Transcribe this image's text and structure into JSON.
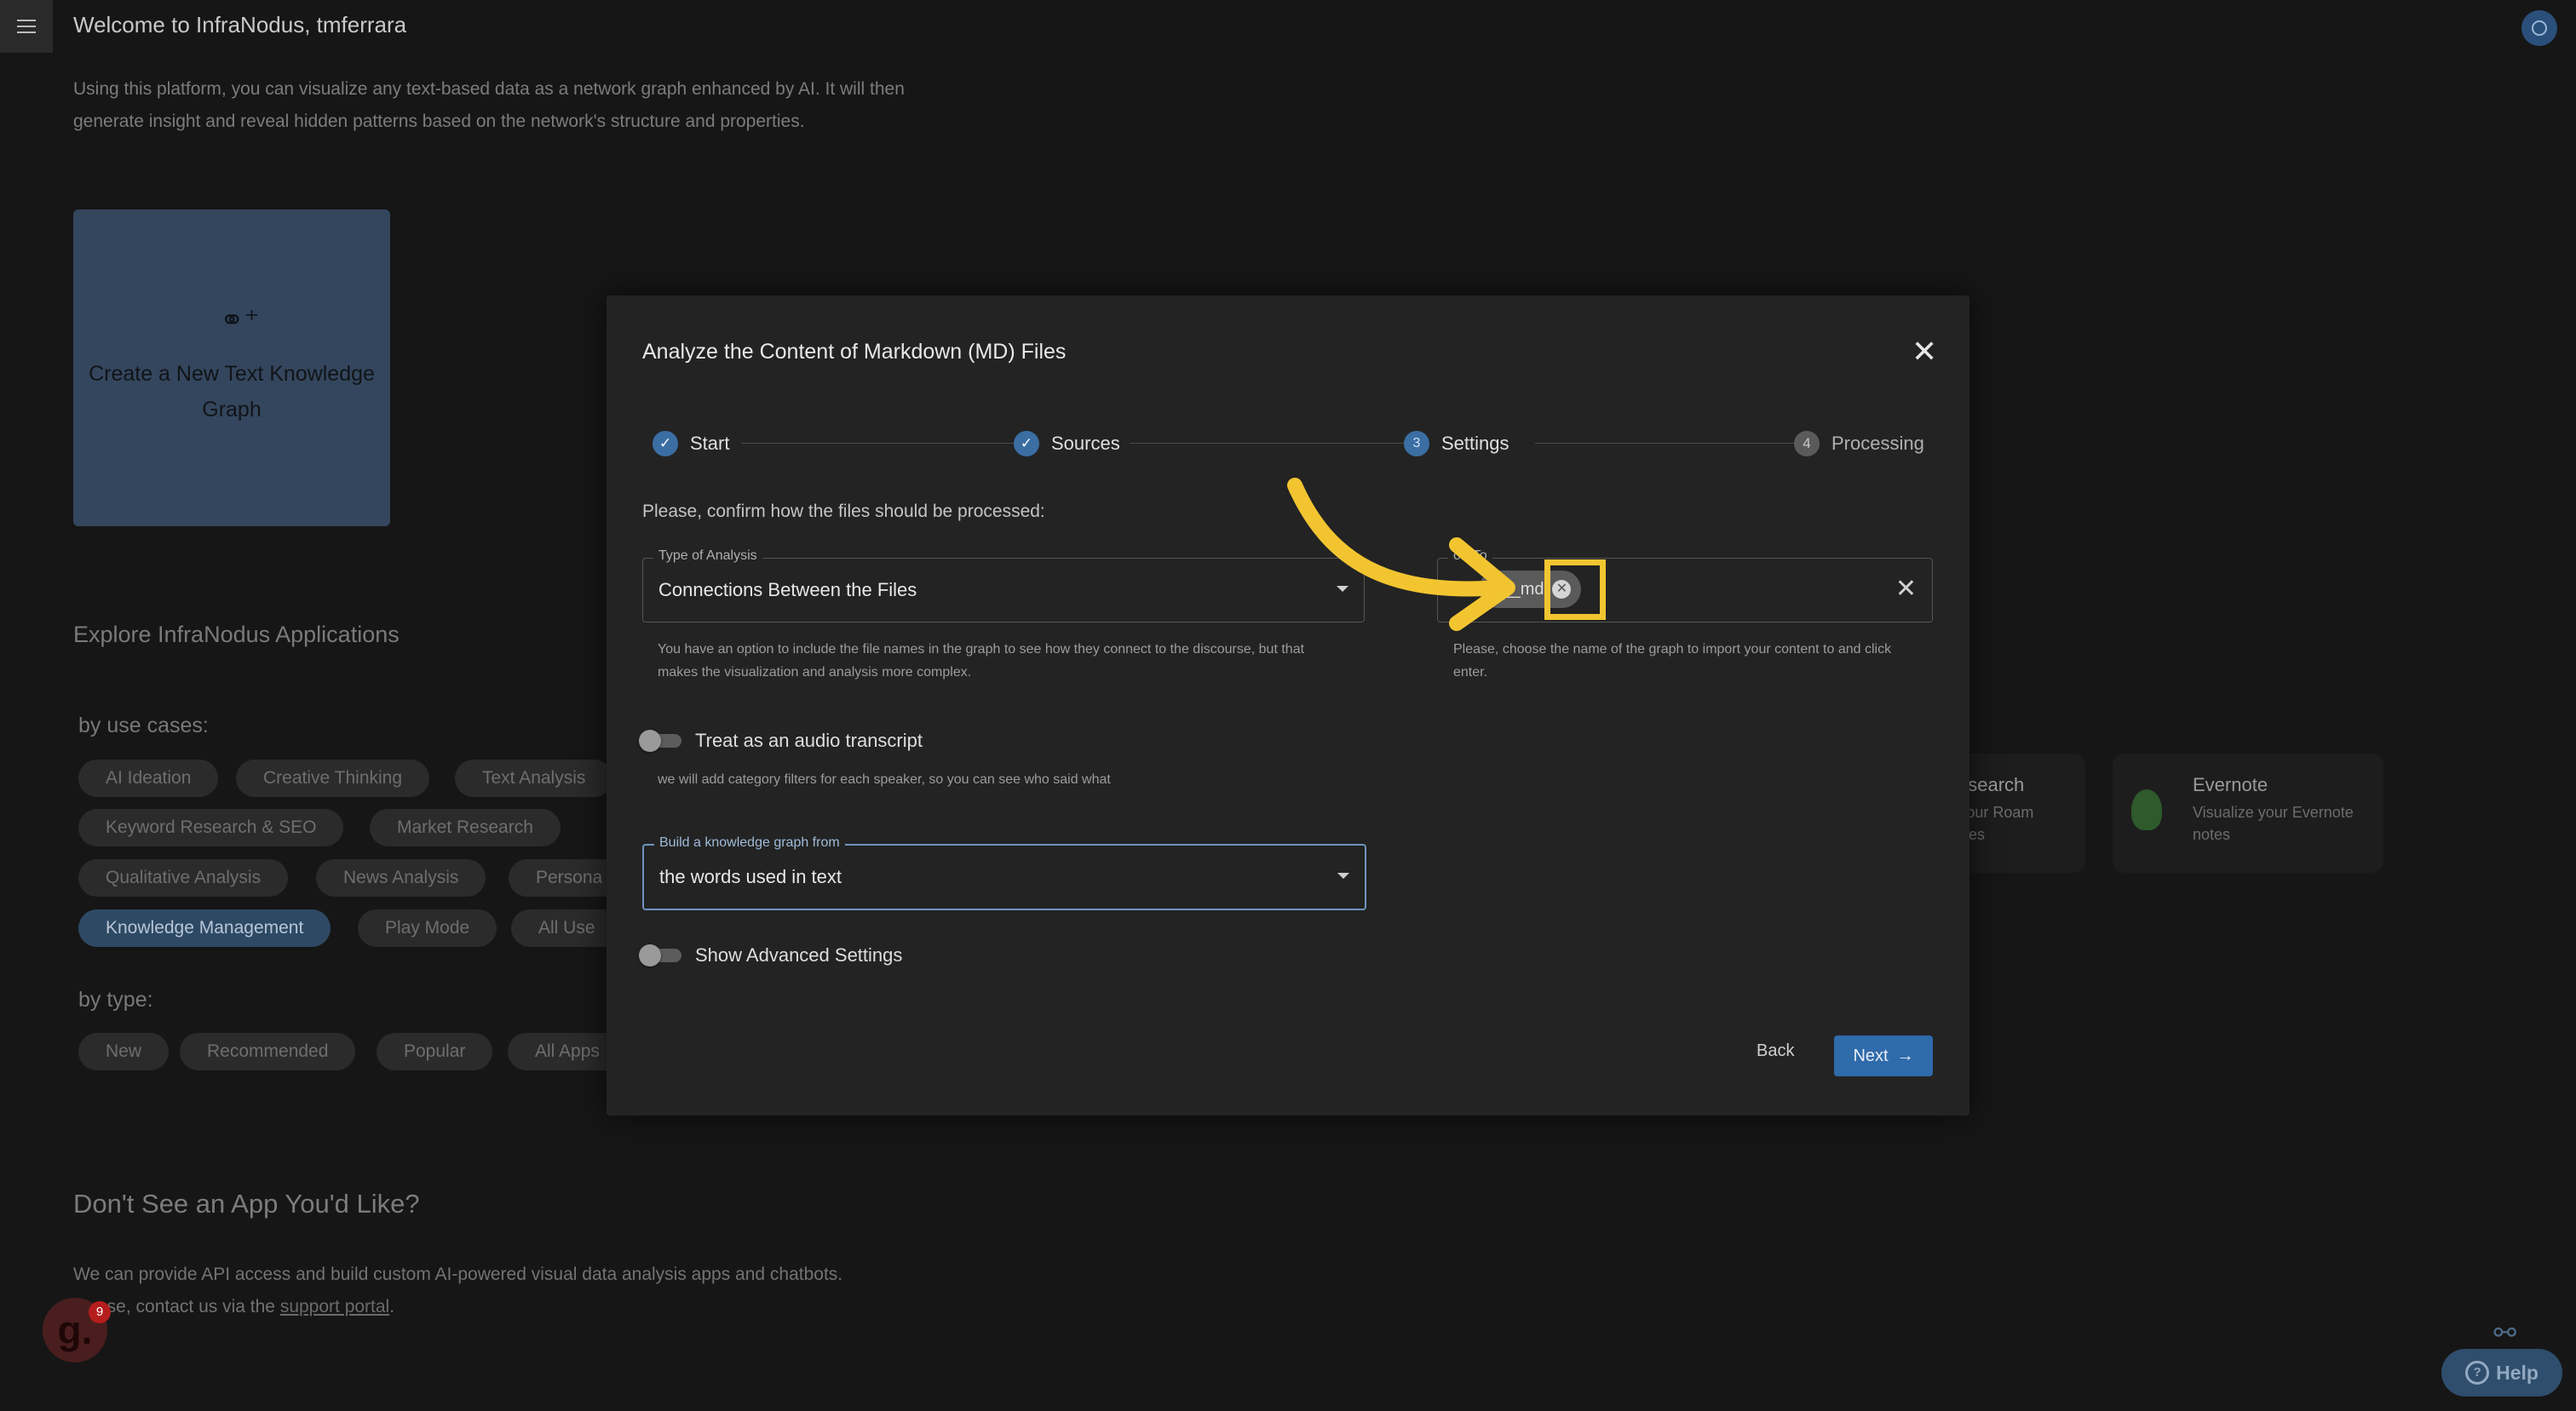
{
  "header": {
    "welcome": "Welcome to InfraNodus, tmferrara",
    "intro": "Using this platform, you can visualize any text-based data as a network graph enhanced by AI. It will then generate insight and reveal hidden patterns based on the network's structure and properties."
  },
  "create_card": {
    "label": "Create a New Text Knowledge Graph"
  },
  "explore": {
    "title": "Explore InfraNodus Applications",
    "by_use_cases": "by use cases:",
    "use_cases": [
      "AI Ideation",
      "Creative Thinking",
      "Text Analysis",
      "Keyword Research & SEO",
      "Market Research",
      "Qualitative Analysis",
      "News Analysis",
      "Persona",
      "Knowledge Management",
      "Play Mode",
      "All Use"
    ],
    "by_type": "by type:",
    "types": [
      "New",
      "Recommended",
      "Popular",
      "All Apps"
    ]
  },
  "apps": {
    "roam_title": "esearch",
    "roam_desc": "Your Roam files",
    "evernote_title": "Evernote",
    "evernote_desc": "Visualize your Evernote notes"
  },
  "bottom": {
    "title": "Don't See an App You'd Like?",
    "line1": "We can provide API access and build custom AI-powered visual data analysis apps and chatbots.",
    "line2_prefix": "ase, contact us via the",
    "link": "support portal",
    "line2_suffix": "."
  },
  "notifications": {
    "count": "9",
    "logo": "g."
  },
  "help": {
    "label": "Help"
  },
  "modal": {
    "title": "Analyze the Content of Markdown (MD) Files",
    "steps": [
      {
        "label": "Start",
        "state": "done"
      },
      {
        "label": "Sources",
        "state": "done"
      },
      {
        "label": "Settings",
        "num": "3",
        "state": "active"
      },
      {
        "label": "Processing",
        "num": "4",
        "state": "pending"
      }
    ],
    "prompt": "Please, confirm how the files should be processed:",
    "analysis_type": {
      "label": "Type of Analysis",
      "value": "Connections Between the Files",
      "helper": "You have an option to include the file names in the graph to see how they connect to the discourse, but that makes the visualization and analysis more complex."
    },
    "import_to": {
      "label": "ort To",
      "chip": "l__md",
      "helper": "Please, choose the name of the graph to import your content to and click enter."
    },
    "audio_toggle": {
      "label": "Treat as an audio transcript",
      "helper": "we will add category filters for each speaker, so you can see who said what"
    },
    "build_from": {
      "label": "Build a knowledge graph from",
      "value": "the words used in text"
    },
    "advanced_toggle": {
      "label": "Show Advanced Settings"
    },
    "back_label": "Back",
    "next_label": "Next"
  },
  "colors": {
    "accent": "#2f6bab",
    "highlight": "#f2c530",
    "active_chip": "#2e4964"
  }
}
